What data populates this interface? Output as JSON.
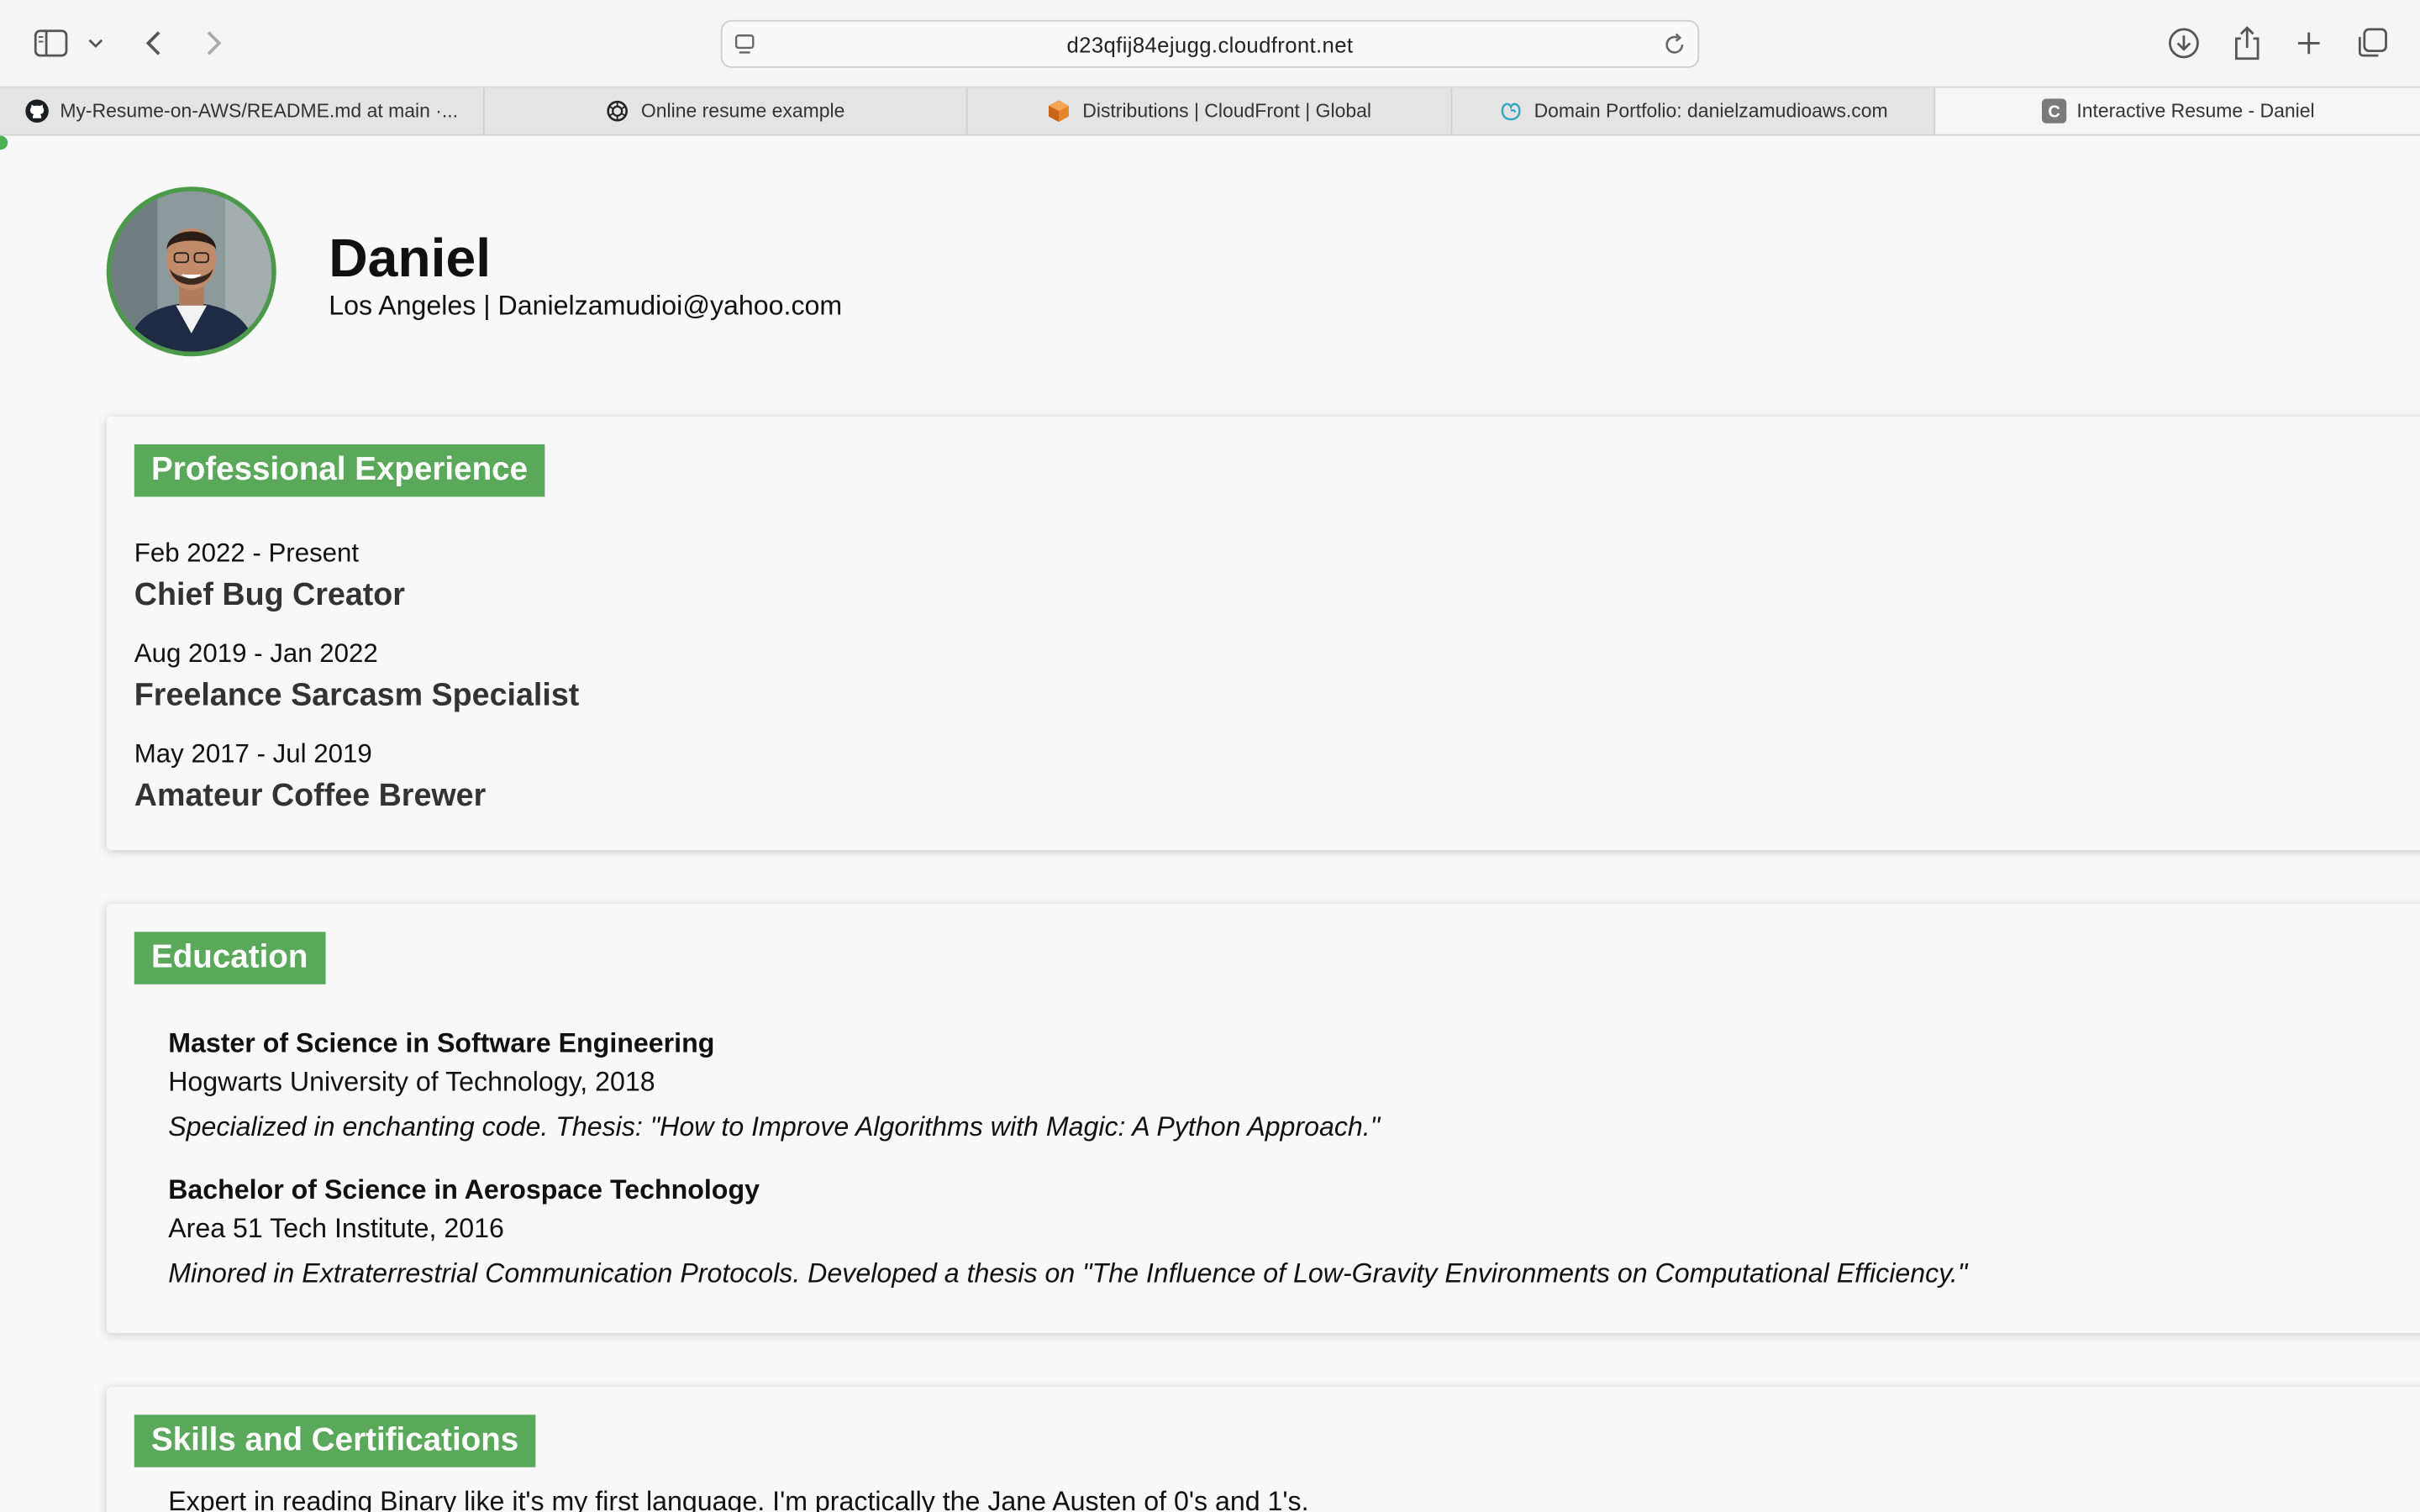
{
  "browser": {
    "url": "d23qfij84ejugg.cloudfront.net",
    "tabs": [
      {
        "label": "My-Resume-on-AWS/README.md at main ·...",
        "icon": "github-icon"
      },
      {
        "label": "Online resume example",
        "icon": "openai-icon"
      },
      {
        "label": "Distributions | CloudFront | Global",
        "icon": "aws-icon"
      },
      {
        "label": "Domain Portfolio: danielzamudioaws.com",
        "icon": "godaddy-icon"
      },
      {
        "label": "Interactive Resume - Daniel",
        "icon": "c-letter-icon"
      }
    ],
    "active_tab_index": 4,
    "accent": "#4caf50"
  },
  "profile": {
    "name": "Daniel",
    "contact": "Los Angeles | Danielzamudioi@yahoo.com"
  },
  "experience": {
    "title": "Professional Experience",
    "items": [
      {
        "date": "Feb 2022 - Present",
        "role": "Chief Bug Creator"
      },
      {
        "date": "Aug 2019 - Jan 2022",
        "role": "Freelance Sarcasm Specialist"
      },
      {
        "date": "May 2017 - Jul 2019",
        "role": "Amateur Coffee Brewer"
      }
    ]
  },
  "education": {
    "title": "Education",
    "items": [
      {
        "degree": "Master of Science in Software Engineering",
        "school": "Hogwarts University of Technology, 2018",
        "description": "Specialized in enchanting code. Thesis: \"How to Improve Algorithms with Magic: A Python Approach.\""
      },
      {
        "degree": "Bachelor of Science in Aerospace Technology",
        "school": "Area 51 Tech Institute, 2016",
        "description": "Minored in Extraterrestrial Communication Protocols. Developed a thesis on \"The Influence of Low-Gravity Environments on Computational Efficiency.\""
      }
    ]
  },
  "skills": {
    "title": "Skills and Certifications",
    "text": "Expert in reading Binary like it's my first language. I'm practically the Jane Austen of 0's and 1's."
  },
  "colors": {
    "section_header_bg": "#5aa85a",
    "avatar_border": "#4a9a4a"
  }
}
